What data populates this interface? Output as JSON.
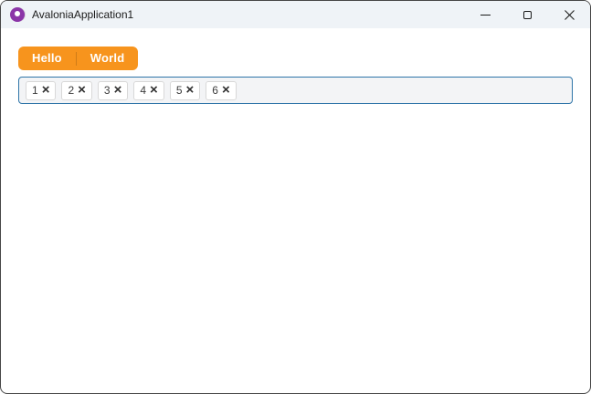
{
  "window": {
    "title": "AvaloniaApplication1",
    "icons": {
      "app": "avalonia-logo-icon",
      "minimize": "minimize-icon",
      "maximize": "maximize-icon",
      "close": "close-icon"
    }
  },
  "tabs": {
    "items": [
      {
        "label": "Hello",
        "selected": true
      },
      {
        "label": "World",
        "selected": false
      }
    ]
  },
  "chips": {
    "items": [
      {
        "label": "1"
      },
      {
        "label": "2"
      },
      {
        "label": "3"
      },
      {
        "label": "4"
      },
      {
        "label": "5"
      },
      {
        "label": "6"
      }
    ],
    "remove_glyph": "×"
  },
  "colors": {
    "accent_orange": "#F7941D",
    "focus_border": "#2D74A8",
    "titlebar_bg": "#EFF3F7",
    "logo_purple": "#8B35A8",
    "chip_border": "#D8D8D8",
    "chipbox_bg": "#F3F4F6"
  }
}
